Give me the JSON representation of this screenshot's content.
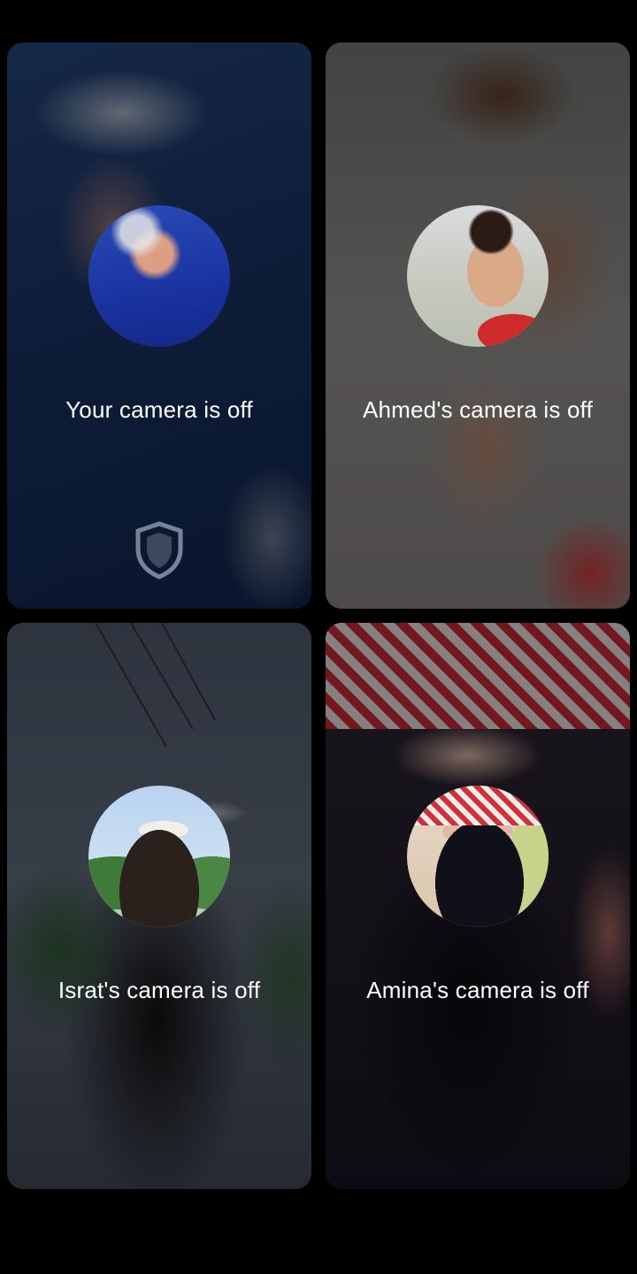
{
  "participants": [
    {
      "name": "Your",
      "status_text": "Your camera is off",
      "avatar_icon": "user-avatar-photo"
    },
    {
      "name": "Ahmed",
      "status_text": "Ahmed's camera is off",
      "avatar_icon": "user-avatar-photo"
    },
    {
      "name": "Israt",
      "status_text": "Israt's camera is off",
      "avatar_icon": "user-avatar-photo"
    },
    {
      "name": "Amina",
      "status_text": "Amina's camera is off",
      "avatar_icon": "user-avatar-photo"
    }
  ],
  "self_tile": {
    "badge_icon": "shield-icon"
  },
  "colors": {
    "background": "#000000",
    "label_text": "#ffffff"
  }
}
